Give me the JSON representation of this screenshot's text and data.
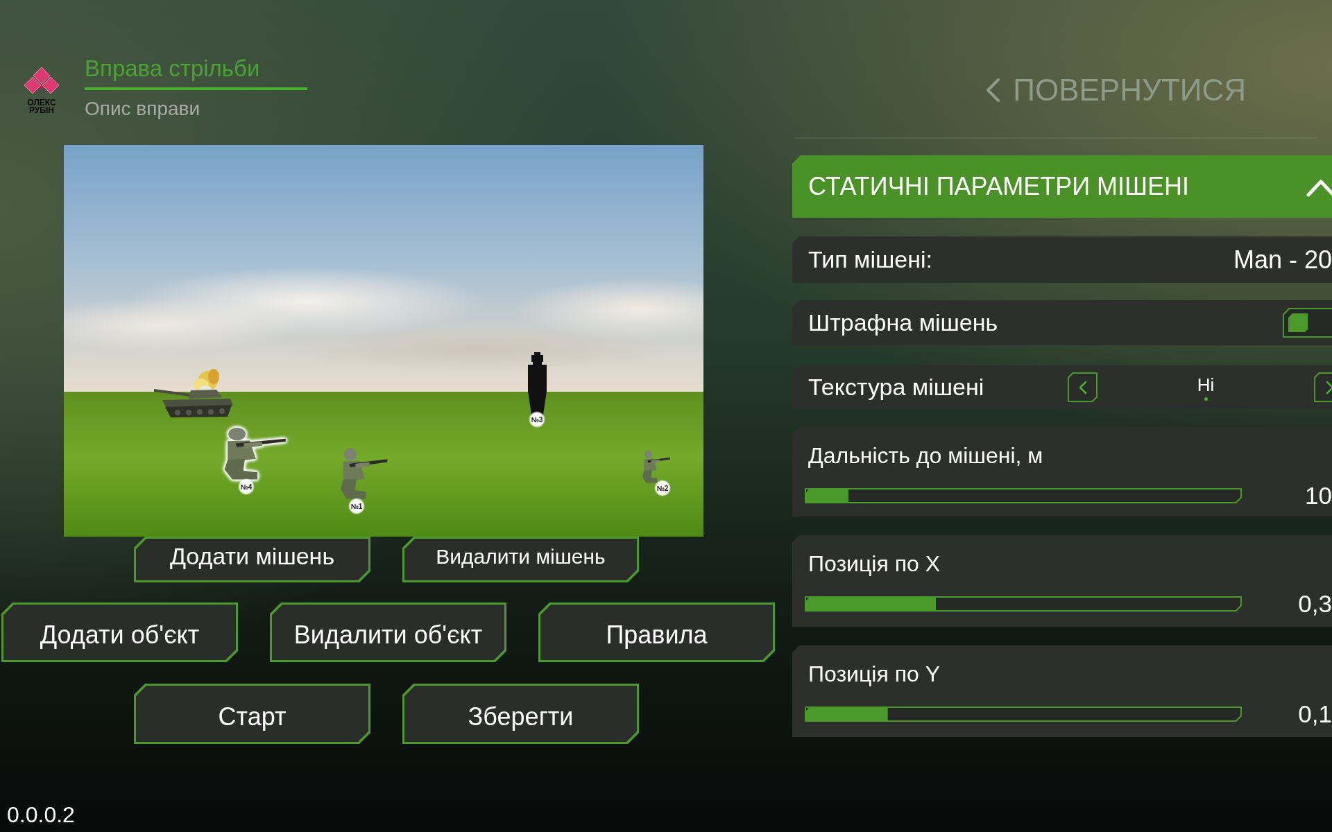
{
  "logo": {
    "text": "ОЛЕКС РУБІН"
  },
  "tabs": [
    {
      "label": "Вправа стрільби",
      "selected": true
    },
    {
      "label": "Опис вправи",
      "selected": false
    }
  ],
  "scene": {
    "objects": [
      {
        "kind": "tank",
        "burning": true
      }
    ],
    "targets": [
      {
        "label": "№4",
        "kind": "soldier",
        "selected": true
      },
      {
        "label": "№1",
        "kind": "soldier",
        "selected": false
      },
      {
        "label": "№3",
        "kind": "figure-target",
        "selected": false
      },
      {
        "label": "№2",
        "kind": "soldier",
        "selected": false
      }
    ]
  },
  "button_rows": [
    {
      "buttons": [
        {
          "label": "Додати мішень"
        },
        {
          "label": "Видалити мішень"
        }
      ]
    },
    {
      "buttons": [
        {
          "label": "Додати об'єкт"
        },
        {
          "label": "Видалити об'єкт"
        },
        {
          "label": "Правила"
        }
      ]
    },
    {
      "buttons": [
        {
          "label": "Старт"
        },
        {
          "label": "Зберегти"
        }
      ]
    }
  ],
  "version": "0.0.0.2",
  "back_button": {
    "label": "ПОВЕРНУТИСЯ"
  },
  "panel": {
    "title": "СТАТИЧНІ ПАРАМЕТРИ МІШЕНІ",
    "expanded": true,
    "rows": [
      {
        "kind": "value",
        "label": "Тип мішені:",
        "value": "Man - 20"
      },
      {
        "kind": "toggle",
        "label": "Штрафна мішень",
        "on": false
      },
      {
        "kind": "selector",
        "label": "Текстура мішені",
        "value": "Ні"
      },
      {
        "kind": "slider",
        "label": "Дальність до мішені, м",
        "level": 0.1,
        "reading": "10"
      },
      {
        "kind": "slider",
        "label": "Позиція по X",
        "level": 0.3,
        "reading": "0,3"
      },
      {
        "kind": "slider",
        "label": "Позиція по Y",
        "level": 0.19,
        "reading": "0,1"
      }
    ]
  }
}
